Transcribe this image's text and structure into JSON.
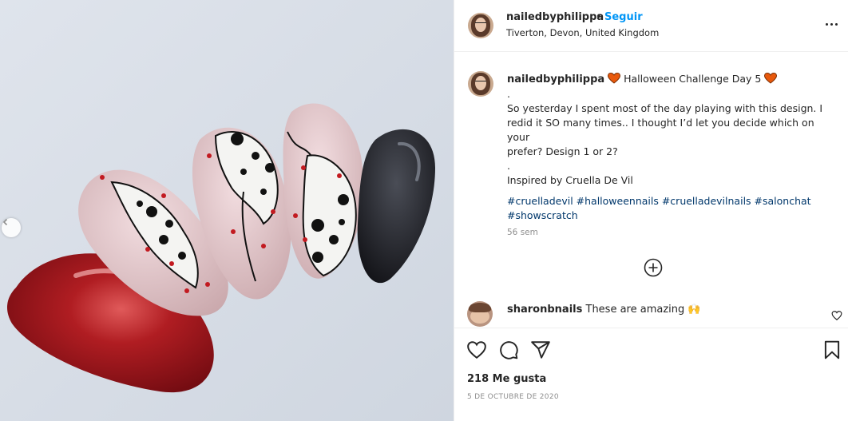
{
  "post": {
    "author": "nailedbyphilippa",
    "separator": "•",
    "follow_label": "Seguir",
    "location": "Tiverton, Devon, United Kingdom",
    "caption": {
      "username": "nailedbyphilippa",
      "title": "Halloween Challenge Day 5",
      "lines": [
        ".",
        "So yesterday I spent most of the day playing with this design. I",
        "redid it SO many times.. I thought I’d let you decide which on your",
        "prefer? Design 1 or 2?",
        ".",
        "Inspired by Cruella De Vil"
      ],
      "hashtags_line1": "#cruelladevil #halloweennails #cruelladevilnails #salonchat",
      "hashtags_line2": "#showscratch"
    },
    "time_ago": "56 sem",
    "comment": {
      "username": "sharonbnails",
      "text": "These are amazing",
      "emoji": "🙌"
    },
    "likes": "218 Me gusta",
    "date": "5 DE OCTUBRE DE 2020"
  },
  "icons": {
    "heart_emoji_color": "#e8590c",
    "brand_blue": "#0095f6",
    "hashtag_color": "#00376b"
  }
}
